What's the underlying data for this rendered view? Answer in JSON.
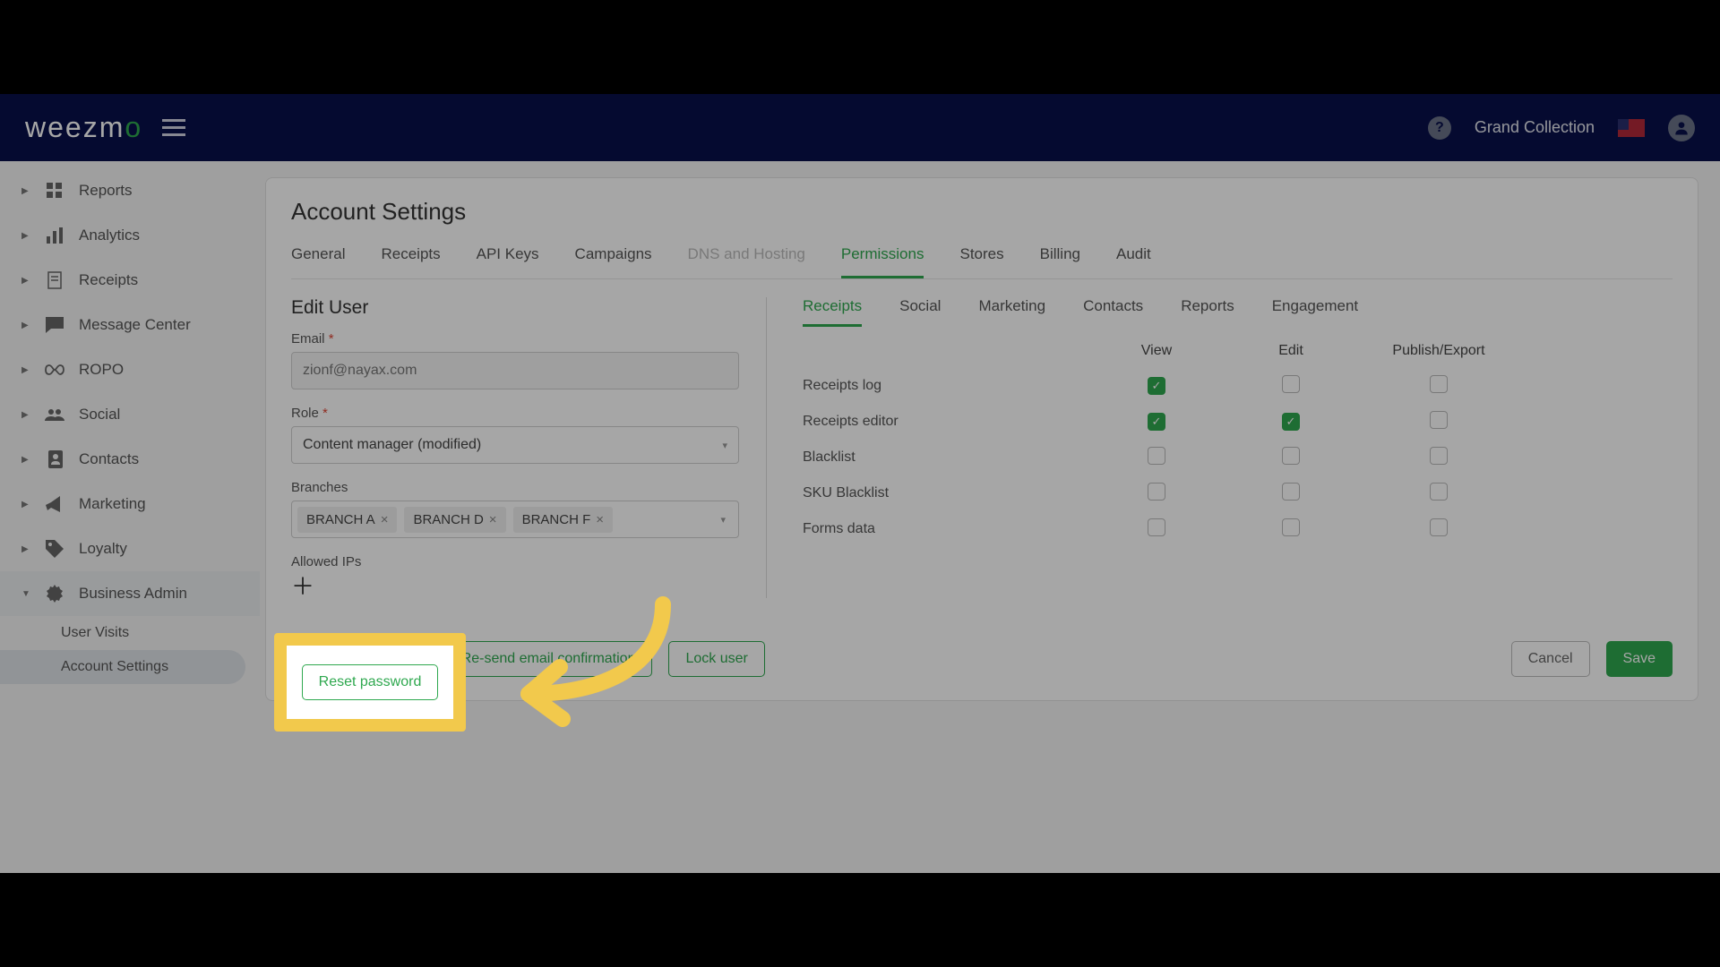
{
  "header": {
    "logo_text": "weezm",
    "logo_accent": "o",
    "company": "Grand Collection"
  },
  "sidebar": {
    "items": [
      {
        "label": "Reports"
      },
      {
        "label": "Analytics"
      },
      {
        "label": "Receipts"
      },
      {
        "label": "Message Center"
      },
      {
        "label": "ROPO"
      },
      {
        "label": "Social"
      },
      {
        "label": "Contacts"
      },
      {
        "label": "Marketing"
      },
      {
        "label": "Loyalty"
      },
      {
        "label": "Business Admin"
      }
    ],
    "sub": [
      {
        "label": "User Visits"
      },
      {
        "label": "Account Settings"
      }
    ]
  },
  "page": {
    "title": "Account Settings",
    "section": "Edit User"
  },
  "tabs": [
    "General",
    "Receipts",
    "API Keys",
    "Campaigns",
    "DNS and Hosting",
    "Permissions",
    "Stores",
    "Billing",
    "Audit"
  ],
  "form": {
    "email_label": "Email",
    "email_value": "zionf@nayax.com",
    "role_label": "Role",
    "role_value": "Content manager (modified)",
    "branches_label": "Branches",
    "branches": [
      "BRANCH A",
      "BRANCH D",
      "BRANCH F"
    ],
    "allowed_ips_label": "Allowed IPs"
  },
  "subtabs": [
    "Receipts",
    "Social",
    "Marketing",
    "Contacts",
    "Reports",
    "Engagement"
  ],
  "perm_columns": [
    "View",
    "Edit",
    "Publish/Export"
  ],
  "perm_rows": [
    {
      "label": "Receipts log",
      "view": true,
      "edit": false,
      "pub": false
    },
    {
      "label": "Receipts editor",
      "view": true,
      "edit": true,
      "pub": false
    },
    {
      "label": "Blacklist",
      "view": false,
      "edit": false,
      "pub": false
    },
    {
      "label": "SKU Blacklist",
      "view": false,
      "edit": false,
      "pub": false
    },
    {
      "label": "Forms data",
      "view": false,
      "edit": false,
      "pub": false
    }
  ],
  "actions": {
    "reset": "Reset password",
    "resend": "Re-send email confirmation",
    "lock": "Lock user",
    "cancel": "Cancel",
    "save": "Save"
  }
}
